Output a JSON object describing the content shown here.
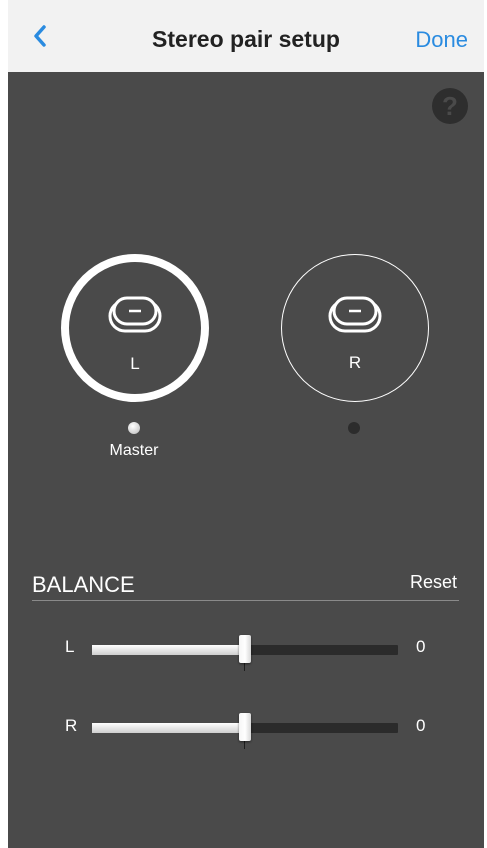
{
  "header": {
    "title": "Stereo pair setup",
    "done_label": "Done",
    "back_icon": "chevron-left-icon",
    "accent_color": "#2a8be0"
  },
  "help": {
    "icon": "question-mark-icon",
    "glyph": "?"
  },
  "speakers": {
    "left": {
      "label": "L",
      "selected": true
    },
    "right": {
      "label": "R",
      "selected": false
    },
    "master_label": "Master"
  },
  "balance": {
    "title": "BALANCE",
    "reset_label": "Reset",
    "rows": [
      {
        "label": "L",
        "value": "0",
        "level": 0.5
      },
      {
        "label": "R",
        "value": "0",
        "level": 0.5
      }
    ]
  }
}
